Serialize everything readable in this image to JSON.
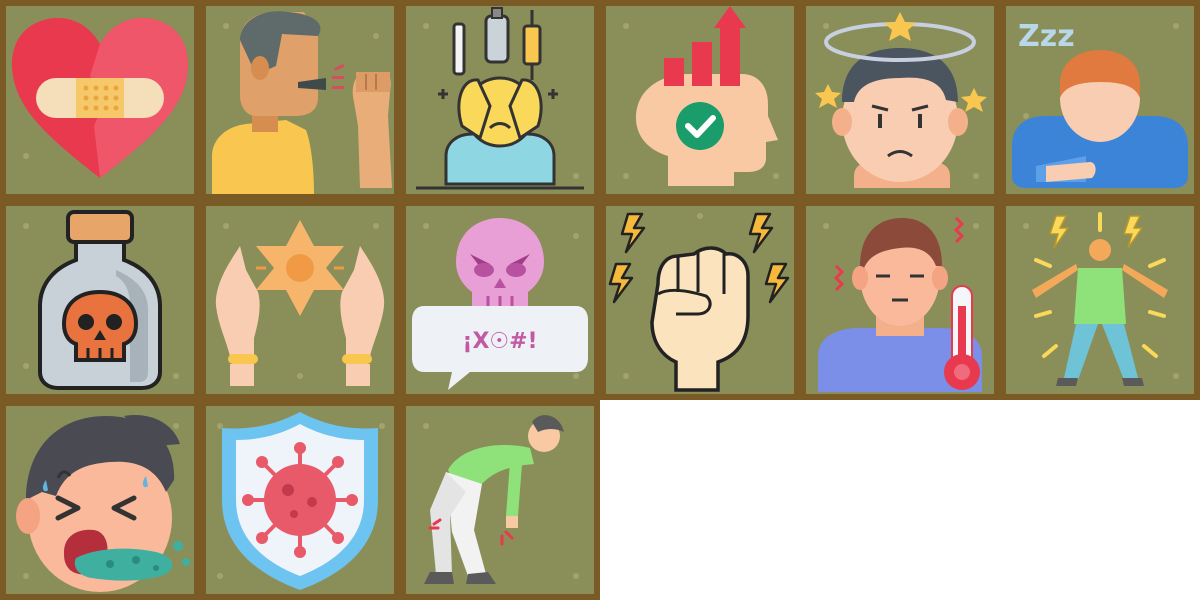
{
  "tiles": [
    {
      "icon": "broken-heart-bandage-icon"
    },
    {
      "icon": "coughing-man-icon"
    },
    {
      "icon": "stressed-person-drugs-icon"
    },
    {
      "icon": "mind-growth-check-icon"
    },
    {
      "icon": "dizzy-man-icon"
    },
    {
      "icon": "sleepy-man-icon"
    },
    {
      "icon": "poison-bottle-icon"
    },
    {
      "icon": "hands-star-healing-icon"
    },
    {
      "icon": "angry-curse-bubble-icon"
    },
    {
      "icon": "fist-power-icon"
    },
    {
      "icon": "fever-thermometer-icon"
    },
    {
      "icon": "shaking-person-icon"
    },
    {
      "icon": "vomiting-man-icon"
    },
    {
      "icon": "virus-shield-icon"
    },
    {
      "icon": "back-pain-person-icon"
    }
  ],
  "curse": {
    "text": "¡X☉#!"
  },
  "sleep": {
    "text": "Zzz"
  },
  "colors": {
    "tile_bg": "#8a8f5a",
    "tile_border": "#7a5a25"
  }
}
